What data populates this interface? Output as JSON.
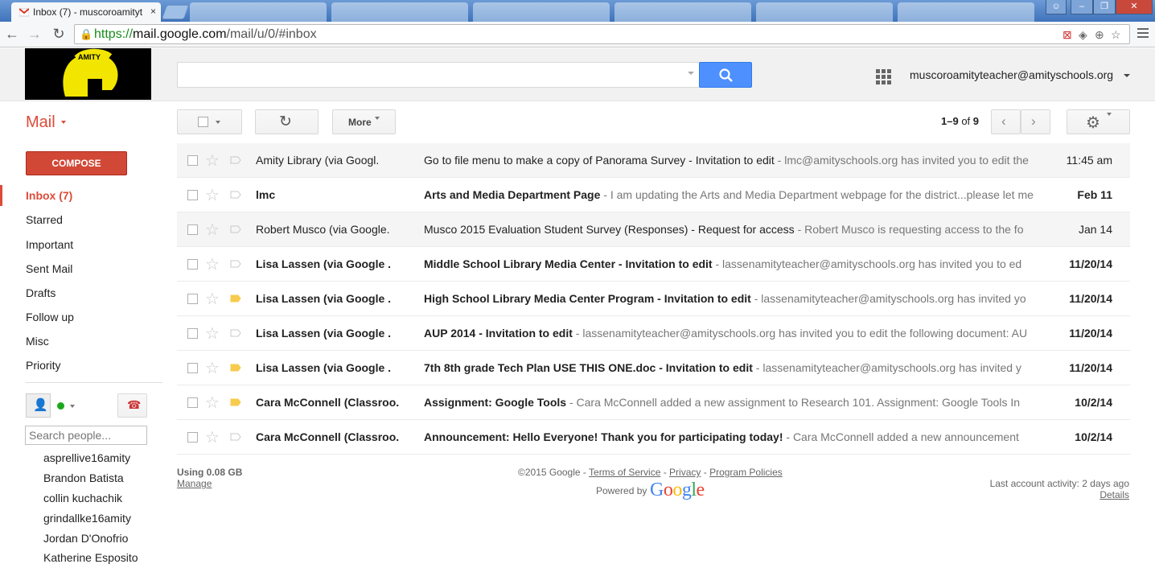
{
  "browser": {
    "active_tab": {
      "title": "Inbox (7) - muscoroamityt",
      "close": "×"
    },
    "inactive_tab_count": 6,
    "url": {
      "scheme": "https://",
      "host": "mail.google.com",
      "path": "/mail/u/0/#inbox"
    }
  },
  "header": {
    "account": "muscoroamityteacher@amityschools.org",
    "logo_text": "AMITY"
  },
  "toolbar": {
    "mail_label": "Mail",
    "more_label": "More",
    "pager": {
      "range": "1–9",
      "of": "of",
      "total": "9"
    }
  },
  "sidebar": {
    "compose": "COMPOSE",
    "items": [
      {
        "label": "Inbox (7)",
        "active": true
      },
      {
        "label": "Starred"
      },
      {
        "label": "Important"
      },
      {
        "label": "Sent Mail"
      },
      {
        "label": "Drafts"
      },
      {
        "label": "Follow up"
      },
      {
        "label": "Misc"
      },
      {
        "label": "Priority"
      }
    ],
    "search_people_placeholder": "Search people...",
    "contacts": [
      "asprellive16amity",
      "Brandon Batista",
      "collin kuchachik",
      "grindallke16amity",
      "Jordan D'Onofrio",
      "Katherine Esposito"
    ]
  },
  "messages": [
    {
      "sender": "Amity Library (via Googl.",
      "subject": "Go to file menu to make a copy of Panorama Survey - Invitation to edit",
      "snippet": " - lmc@amityschools.org has invited you to edit the",
      "date": "11:45 am",
      "unread": false,
      "labeled": false
    },
    {
      "sender": "lmc",
      "subject": "Arts and Media Department Page",
      "snippet": " - I am updating the Arts and Media Department webpage for the district...please let me",
      "date": "Feb 11",
      "unread": true,
      "labeled": false
    },
    {
      "sender": "Robert Musco (via Google.",
      "subject": "Musco 2015 Evaluation Student Survey (Responses) - Request for access",
      "snippet": " - Robert Musco is requesting access to the fo",
      "date": "Jan 14",
      "unread": false,
      "labeled": false
    },
    {
      "sender": "Lisa Lassen (via Google .",
      "subject": "Middle School Library Media Center - Invitation to edit",
      "snippet": " - lassenamityteacher@amityschools.org has invited you to ed",
      "date": "11/20/14",
      "unread": true,
      "labeled": false
    },
    {
      "sender": "Lisa Lassen (via Google .",
      "subject": "High School Library Media Center Program - Invitation to edit",
      "snippet": " - lassenamityteacher@amityschools.org has invited yo",
      "date": "11/20/14",
      "unread": true,
      "labeled": true
    },
    {
      "sender": "Lisa Lassen (via Google .",
      "subject": "AUP 2014 - Invitation to edit",
      "snippet": " - lassenamityteacher@amityschools.org has invited you to edit the following document: AU",
      "date": "11/20/14",
      "unread": true,
      "labeled": false
    },
    {
      "sender": "Lisa Lassen (via Google .",
      "subject": "7th 8th grade Tech Plan USE THIS ONE.doc - Invitation to edit",
      "snippet": " - lassenamityteacher@amityschools.org has invited y",
      "date": "11/20/14",
      "unread": true,
      "labeled": true
    },
    {
      "sender": "Cara McConnell (Classroo.",
      "subject": "Assignment: Google Tools",
      "snippet": " - Cara McConnell added a new assignment to Research 101. Assignment: Google Tools In",
      "date": "10/2/14",
      "unread": true,
      "labeled": true
    },
    {
      "sender": "Cara McConnell (Classroo.",
      "subject": "Announcement: Hello Everyone! Thank you for participating today!",
      "snippet": " - Cara McConnell added a new announcement",
      "date": "10/2/14",
      "unread": true,
      "labeled": false
    }
  ],
  "footer": {
    "usage": "Using 0.08 GB",
    "manage": "Manage",
    "copyright": "©2015 Google - ",
    "terms": "Terms of Service",
    "sep": " - ",
    "privacy": "Privacy",
    "policies": "Program Policies",
    "powered": "Powered by",
    "google": "Google",
    "activity": "Last account activity: 2 days ago",
    "details": "Details"
  },
  "colors": {
    "accent_red": "#dd4b39",
    "compose_red": "#d14836",
    "search_blue": "#4d90fe",
    "label_yellow": "#f7cb4d"
  }
}
